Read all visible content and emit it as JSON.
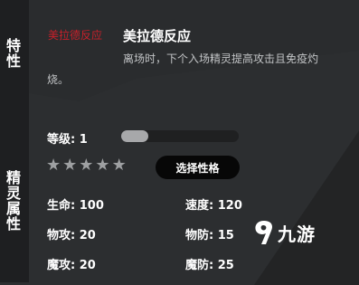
{
  "sidebar": {
    "trait_heading": "特性",
    "attributes_heading": "精灵属性"
  },
  "trait": {
    "tag": "美拉德反应",
    "name": "美拉德反应",
    "description": "离场时，下个入场精灵提高攻击且免疫灼烧。"
  },
  "level": {
    "label": "等级: 1",
    "progress_fraction": 0.23
  },
  "stars": {
    "count": 5,
    "glyph": "★"
  },
  "nature_button": {
    "label": "选择性格"
  },
  "stats": {
    "hp": "生命: 100",
    "speed": "速度: 120",
    "atk": "物攻: 20",
    "def": "物防: 15",
    "matk": "魔攻: 20",
    "mdef": "魔防: 25"
  },
  "watermark": {
    "text": "九游"
  },
  "colors": {
    "accent_red": "#c8202a",
    "button_bg": "#070707"
  }
}
